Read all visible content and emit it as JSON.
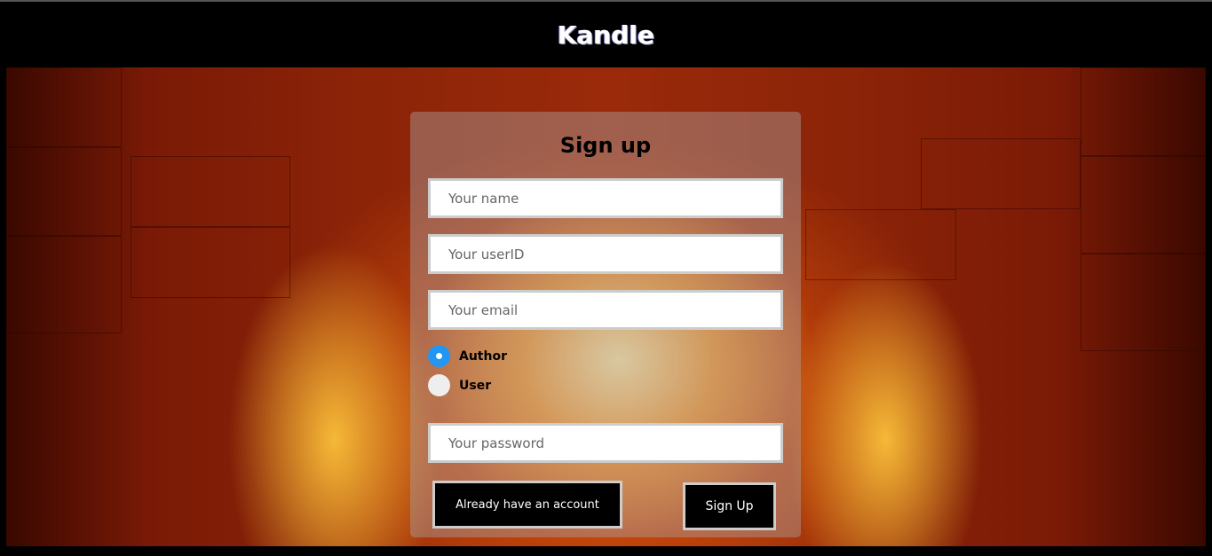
{
  "header": {
    "brand": "Kandle"
  },
  "form": {
    "title": "Sign up",
    "name_placeholder": "Your name",
    "userid_placeholder": "Your userID",
    "email_placeholder": "Your email",
    "roles": [
      {
        "label": "Author",
        "selected": true
      },
      {
        "label": "User",
        "selected": false
      }
    ],
    "password_placeholder": "Your password",
    "login_button": "Already have an account",
    "signup_button": "Sign Up"
  },
  "colors": {
    "radio_selected": "#2196f3"
  }
}
